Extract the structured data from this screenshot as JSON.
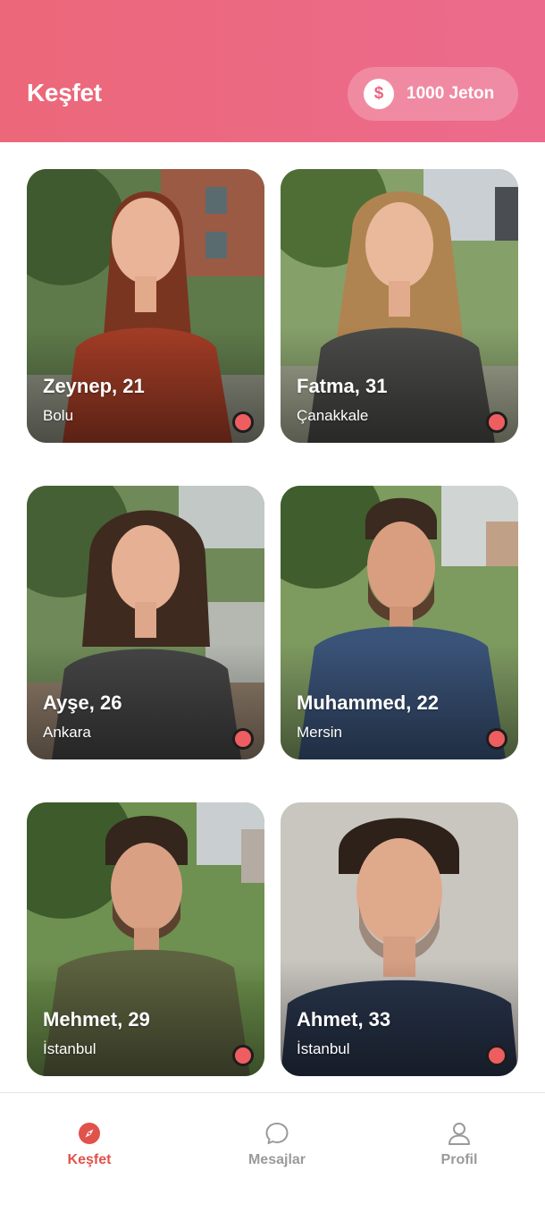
{
  "header": {
    "title": "Keşfet",
    "coins": {
      "icon": "dollar-coin-icon",
      "symbol": "$",
      "label": "1000 Jeton"
    }
  },
  "profiles": [
    {
      "name": "Zeynep, 21",
      "city": "Bolu",
      "status": "offline",
      "status_color": "#ee5e60"
    },
    {
      "name": "Fatma, 31",
      "city": "Çanakkale",
      "status": "offline",
      "status_color": "#ee5e60"
    },
    {
      "name": "Ayşe, 26",
      "city": "Ankara",
      "status": "offline",
      "status_color": "#ee5e60"
    },
    {
      "name": "Muhammed, 22",
      "city": "Mersin",
      "status": "offline",
      "status_color": "#ee5e60"
    },
    {
      "name": "Mehmet, 29",
      "city": "İstanbul",
      "status": "offline",
      "status_color": "#ee5e60"
    },
    {
      "name": "Ahmet, 33",
      "city": "İstanbul",
      "status": "offline",
      "status_color": "#ee5e60"
    }
  ],
  "nav": {
    "items": [
      {
        "label": "Keşfet",
        "icon": "compass-icon",
        "active": true
      },
      {
        "label": "Mesajlar",
        "icon": "chat-bubble-icon",
        "active": false
      },
      {
        "label": "Profil",
        "icon": "user-icon",
        "active": false
      }
    ]
  },
  "colors": {
    "brand_gradient_start": "#ec6779",
    "brand_gradient_end": "#ec6b8d",
    "active_nav": "#e0524a",
    "inactive_nav": "#9a9a9a"
  }
}
